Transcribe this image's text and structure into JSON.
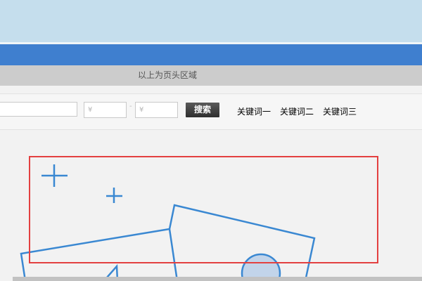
{
  "header": {
    "region_note": "以上为页头区域"
  },
  "search": {
    "keyword_value": "",
    "price_min_placeholder": "¥",
    "price_max_placeholder": "¥",
    "separator": "-",
    "button_label": "搜索",
    "hot_keywords": [
      "关键词一",
      "关键词二",
      "关键词三"
    ]
  },
  "colors": {
    "banner": "#c5deed",
    "nav_bar": "#3f7fcf",
    "note_bar": "#cccccc",
    "highlight": "#e34040",
    "illustration_stroke": "#3a88d2"
  },
  "icons": [
    "plus-icon",
    "plus-icon",
    "image-placeholder-icon"
  ]
}
